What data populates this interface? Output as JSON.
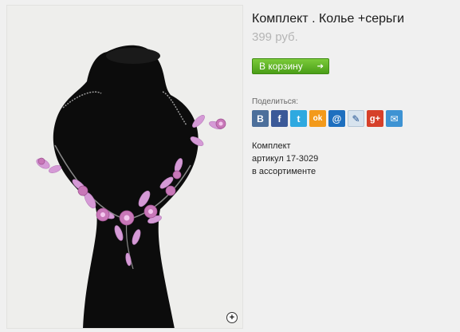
{
  "product": {
    "title": "Комплект . Колье +серьги",
    "price": "399 руб.",
    "image_alt": "necklace-on-black-bust"
  },
  "cart": {
    "label": "В корзину",
    "arrow": "➔"
  },
  "share": {
    "label": "Поделиться:",
    "buttons": [
      {
        "name": "vkontakte",
        "glyph": "B",
        "color": "#4c6f9b"
      },
      {
        "name": "facebook",
        "glyph": "f",
        "color": "#3b5998"
      },
      {
        "name": "twitter",
        "glyph": "t",
        "color": "#2fa9e0"
      },
      {
        "name": "odnoklassniki",
        "glyph": "ok",
        "color": "#f39a1b"
      },
      {
        "name": "mail-ru",
        "glyph": "@",
        "color": "#1e6fbf"
      },
      {
        "name": "livejournal",
        "glyph": "✎",
        "color": "#d7e3ee"
      },
      {
        "name": "google-plus",
        "glyph": "g+",
        "color": "#d6402a"
      },
      {
        "name": "email",
        "glyph": "✉",
        "color": "#3e93d3"
      }
    ]
  },
  "info": {
    "line1": "Комплект",
    "line2": "артикул 17-3029",
    "line3": "в ассортименте"
  },
  "zoom_icon": "+"
}
